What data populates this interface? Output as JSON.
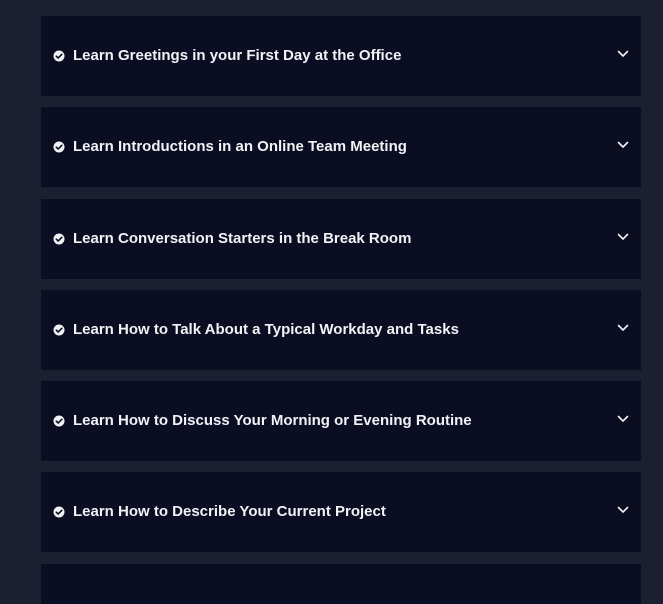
{
  "accordion": {
    "items": [
      {
        "label": "Learn Greetings in your First Day at the Office",
        "icon": "check-circle-icon",
        "toggle_icon": "chevron-down-icon"
      },
      {
        "label": "Learn Introductions in an Online Team Meeting",
        "icon": "check-circle-icon",
        "toggle_icon": "chevron-down-icon"
      },
      {
        "label": "Learn Conversation Starters in the Break Room",
        "icon": "check-circle-icon",
        "toggle_icon": "chevron-down-icon"
      },
      {
        "label": "Learn How to Talk About a Typical Workday and Tasks",
        "icon": "check-circle-icon",
        "toggle_icon": "chevron-down-icon"
      },
      {
        "label": "Learn How to Discuss Your Morning or Evening Routine",
        "icon": "check-circle-icon",
        "toggle_icon": "chevron-down-icon"
      },
      {
        "label": "Learn How to Describe Your Current Project",
        "icon": "check-circle-icon",
        "toggle_icon": "chevron-down-icon"
      }
    ]
  },
  "colors": {
    "page_background": "#1c1e31",
    "item_background": "#0b0d22",
    "text": "#f2f2f5"
  }
}
